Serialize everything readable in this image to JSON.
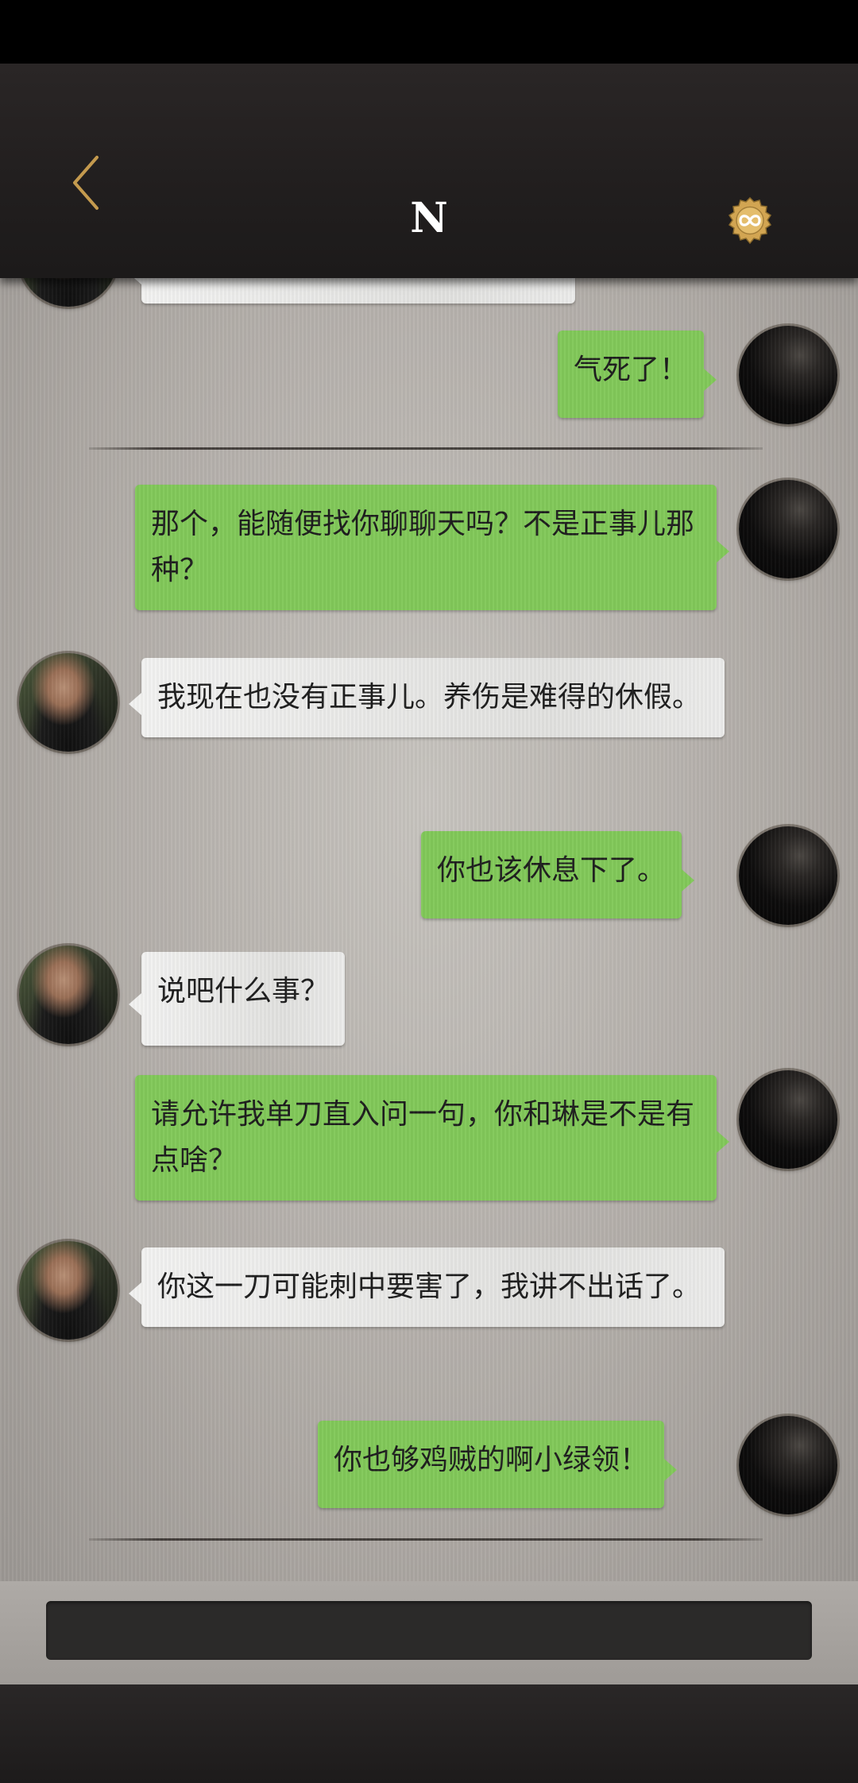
{
  "header": {
    "title": "N",
    "back_icon": "chevron-left-icon",
    "badge_icon": "infinity-badge-icon",
    "accent": "#c49a4e"
  },
  "colors": {
    "outgoing_bubble": "#82c95a",
    "incoming_bubble": "#f0f0ef"
  },
  "messages": [
    {
      "sender": "me",
      "text": "气死了！"
    },
    {
      "sender": "me",
      "text": "那个，能随便找你聊聊天吗？不是正事儿那种？"
    },
    {
      "sender": "npc",
      "text": "我现在也没有正事儿。养伤是难得的休假。"
    },
    {
      "sender": "me",
      "text": "你也该休息下了。"
    },
    {
      "sender": "npc",
      "text": "说吧什么事？"
    },
    {
      "sender": "me",
      "text": "请允许我单刀直入问一句，你和琳是不是有点啥？"
    },
    {
      "sender": "npc",
      "text": "你这一刀可能刺中要害了，我讲不出话了。"
    },
    {
      "sender": "me",
      "text": "你也够鸡贼的啊小绿领！"
    }
  ]
}
